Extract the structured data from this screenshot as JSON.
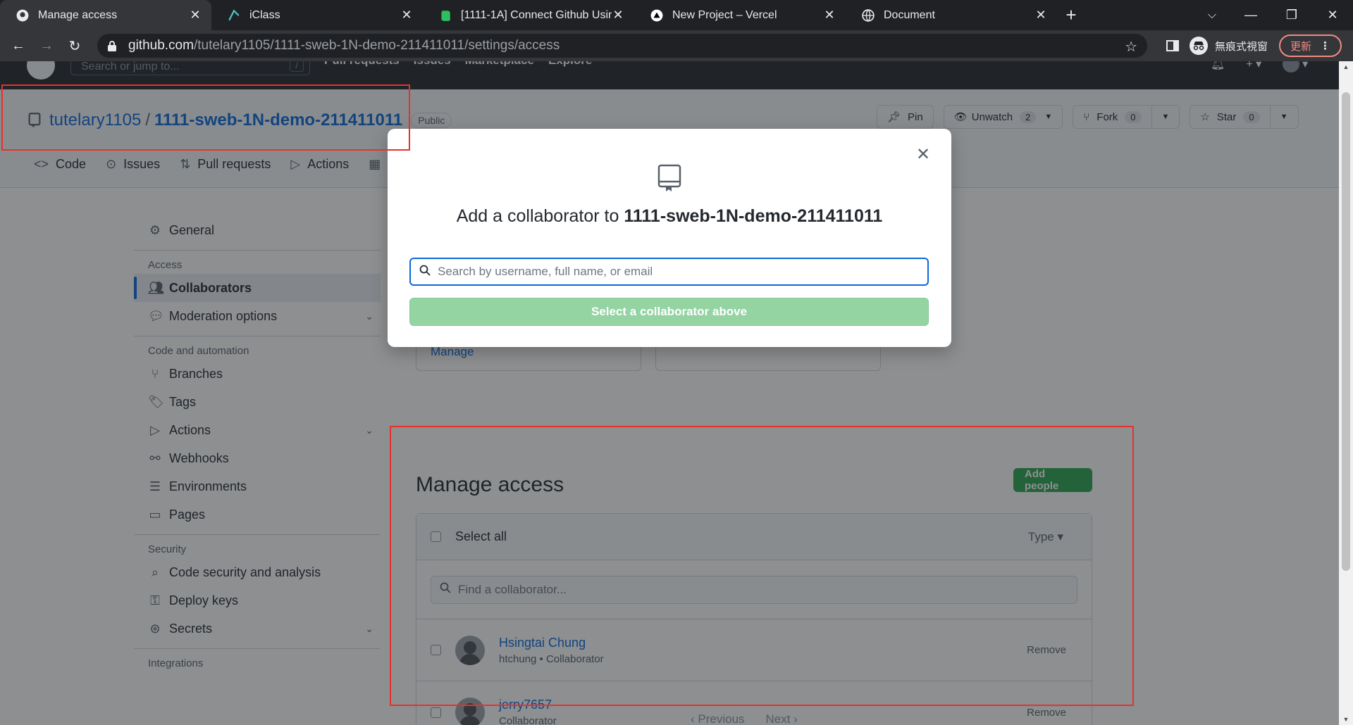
{
  "browser": {
    "tabs": [
      {
        "title": "Manage access",
        "active": true,
        "icon": "github-icon"
      },
      {
        "title": "iClass",
        "active": false,
        "icon": "iclass-icon"
      },
      {
        "title": "[1111-1A] Connect Github Usin",
        "active": false,
        "icon": "evernote-icon"
      },
      {
        "title": "New Project – Vercel",
        "active": false,
        "icon": "vercel-icon"
      },
      {
        "title": "Document",
        "active": false,
        "icon": "globe-icon"
      }
    ],
    "url_host": "github.com",
    "url_path": "/tutelary1105/1111-sweb-1N-demo-211411011/settings/access",
    "incognito_label": "無痕式視窗",
    "update_label": "更新"
  },
  "header": {
    "search_placeholder": "Search or jump to...",
    "search_shortcut": "/",
    "nav": [
      "Pull requests",
      "Issues",
      "Marketplace",
      "Explore"
    ]
  },
  "repo": {
    "owner": "tutelary1105",
    "name": "1111-sweb-1N-demo-211411011",
    "visibility": "Public",
    "pin_label": "Pin",
    "unwatch_label": "Unwatch",
    "watch_count": "2",
    "fork_label": "Fork",
    "fork_count": "0",
    "star_label": "Star",
    "star_count": "0",
    "tabs": [
      "Code",
      "Issues",
      "Pull requests",
      "Actions"
    ]
  },
  "sidebar": {
    "general": "General",
    "groups": {
      "access": "Access",
      "code_automation": "Code and automation",
      "security": "Security",
      "integrations": "Integrations"
    },
    "collaborators": "Collaborators",
    "moderation": "Moderation options",
    "branches": "Branches",
    "tags": "Tags",
    "actions": "Actions",
    "webhooks": "Webhooks",
    "environments": "Environments",
    "pages": "Pages",
    "code_security": "Code security and analysis",
    "deploy_keys": "Deploy keys",
    "secrets": "Secrets"
  },
  "main": {
    "manage_link": "Manage",
    "title": "Manage access",
    "add_people": "Add people",
    "select_all": "Select all",
    "type_filter": "Type",
    "find_placeholder": "Find a collaborator...",
    "collaborators": [
      {
        "name": "Hsingtai Chung",
        "sub": "htchung • Collaborator",
        "action": "Remove"
      },
      {
        "name": "jerry7657",
        "sub": "Collaborator",
        "action": "Remove"
      }
    ],
    "prev": "Previous",
    "next": "Next"
  },
  "modal": {
    "title_prefix": "Add a collaborator to",
    "title_repo": "1111-sweb-1N-demo-211411011",
    "search_placeholder": "Search by username, full name, or email",
    "select_button": "Select a collaborator above"
  }
}
